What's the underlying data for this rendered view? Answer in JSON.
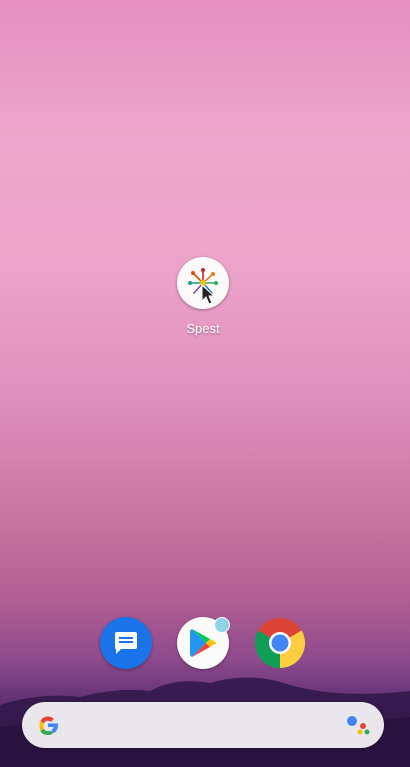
{
  "home": {
    "apps": [
      {
        "label": "Spest",
        "icon": "spest-icon"
      }
    ]
  },
  "dock": {
    "items": [
      {
        "icon": "messages-icon",
        "color": "#1a73e8"
      },
      {
        "icon": "play-store-icon",
        "notification": true
      },
      {
        "icon": "chrome-icon"
      }
    ]
  },
  "search_bar": {
    "logo": "google-g-icon",
    "assistant": "google-assistant-icon"
  },
  "colors": {
    "wallpaper_top": "#e58fc0",
    "wallpaper_bottom": "#3a1d52",
    "search_bar": "#e9e7ec"
  }
}
